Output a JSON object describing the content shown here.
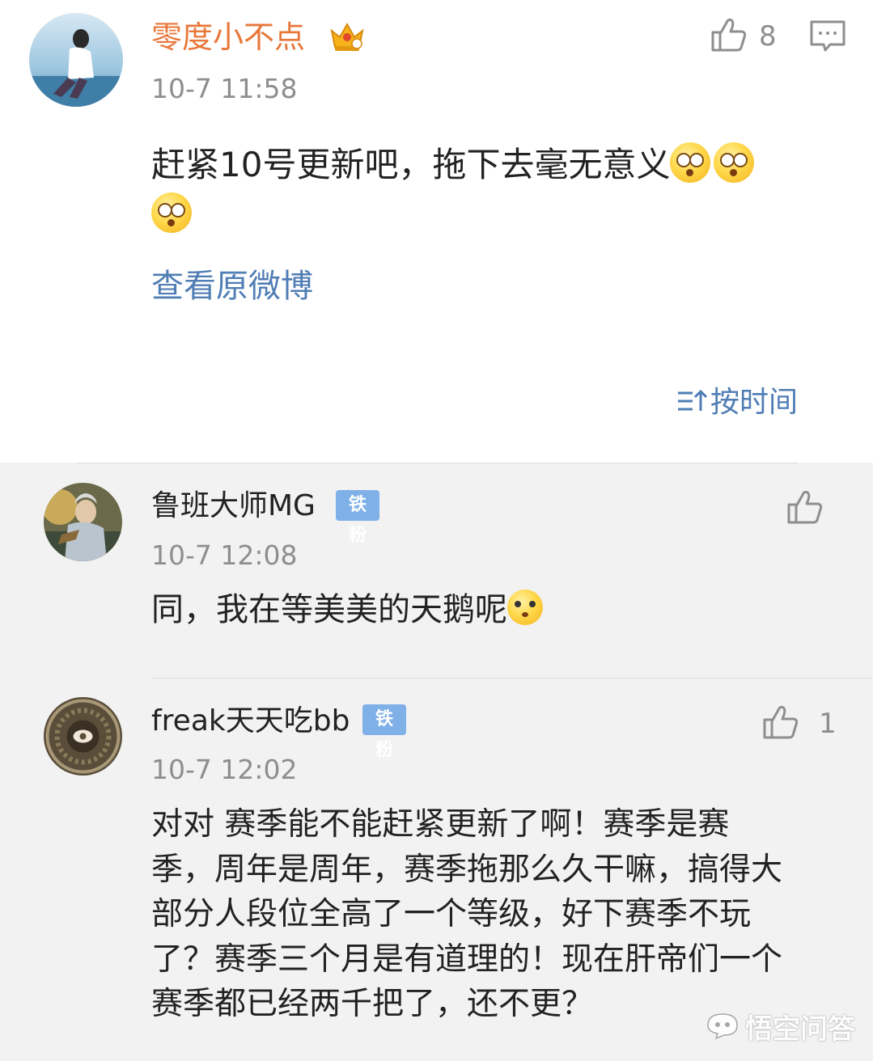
{
  "main_comment": {
    "username": "零度小不点",
    "timestamp": "10-7 11:58",
    "like_count": "8",
    "text_line1": "赶紧10号更新吧，拖下去毫无意义",
    "view_original_label": "查看原微博",
    "username_color": "#e8773a"
  },
  "sort": {
    "label": "按时间"
  },
  "replies": [
    {
      "username": "鲁班大师MG",
      "badge": "铁粉",
      "timestamp": "10-7 12:08",
      "like_count": "",
      "text_line1": "同，我在等美美的天鹅呢"
    },
    {
      "username": "freak天天吃bb",
      "badge": "铁粉",
      "timestamp": "10-7 12:02",
      "like_count": "1",
      "lines": [
        "对对 赛季能不能赶紧更新了啊！赛季是赛",
        "季，周年是周年，赛季拖那么久干嘛，搞得大",
        "部分人段位全高了一个等级，好下赛季不玩",
        "了？赛季三个月是有道理的！现在肝帝们一个",
        "赛季都已经两千把了，还不更？"
      ]
    }
  ],
  "watermark": {
    "text": "悟空问答"
  },
  "colors": {
    "link_blue": "#4f7db4",
    "badge_blue": "#7fb0e8",
    "reply_background": "#f2f2f2",
    "icon_gray": "#8e8e8e"
  },
  "icons": {
    "like": "thumbs-up-icon",
    "comment": "comment-bubble-icon",
    "sort": "sort-icon",
    "crown": "crown-icon",
    "emoji": "dizzy-face-emoji"
  }
}
